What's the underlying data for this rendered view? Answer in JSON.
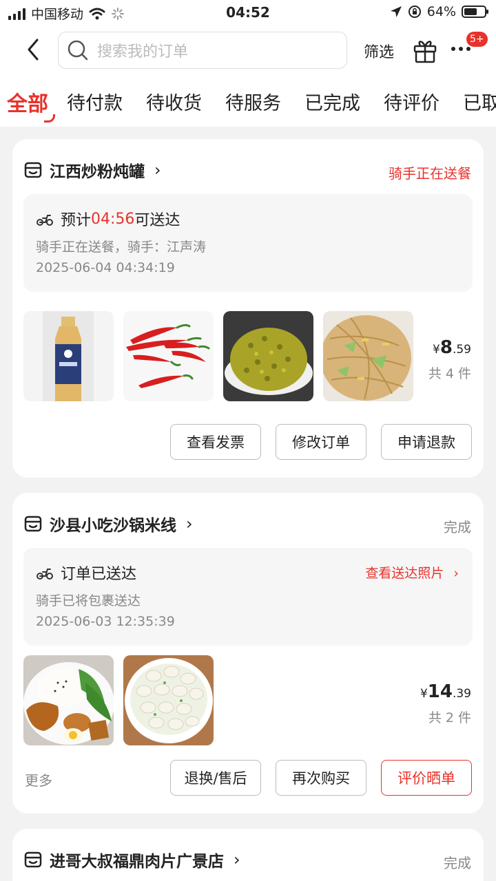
{
  "status_bar": {
    "carrier": "中国移动",
    "time": "04:52",
    "battery": "64%",
    "battery_level": 0.64
  },
  "header": {
    "search_placeholder": "搜索我的订单",
    "filter_label": "筛选",
    "more_badge": "5+"
  },
  "tabs": [
    {
      "label": "全部",
      "active": true
    },
    {
      "label": "待付款"
    },
    {
      "label": "待收货"
    },
    {
      "label": "待服务"
    },
    {
      "label": "已完成"
    },
    {
      "label": "待评价"
    },
    {
      "label": "已取"
    }
  ],
  "orders": [
    {
      "shop": "江西炒粉炖罐",
      "status": "骑手正在送餐",
      "eta_prefix": "预计",
      "eta_time": "04:56",
      "eta_suffix": "可送达",
      "rider_text": "骑手正在送餐，骑手：江声涛",
      "timestamp": "2025-06-04 04:34:19",
      "items": [
        "tea-bottle",
        "red-chili",
        "pickled-beans",
        "fried-rice-noodles"
      ],
      "price_symbol": "¥",
      "price_int": "8",
      "price_dec": ".59",
      "count": "共 4 件",
      "buttons": [
        "查看发票",
        "修改订单",
        "申请退款"
      ]
    },
    {
      "shop": "沙县小吃沙锅米线",
      "status": "完成",
      "delivered_label": "订单已送达",
      "photo_link": "查看送达照片",
      "rider_text": "骑手已将包裹送达",
      "timestamp": "2025-06-03 12:35:39",
      "items": [
        "chicken-leg-rice",
        "wonton-soup"
      ],
      "price_symbol": "¥",
      "price_int": "14",
      "price_dec": ".39",
      "count": "共 2 件",
      "more": "更多",
      "buttons": [
        "退换/售后",
        "再次购买",
        "评价晒单"
      ]
    },
    {
      "shop": "进哥大叔福鼎肉片广景店",
      "status": "完成"
    }
  ],
  "colors": {
    "accent": "#e8322b",
    "text": "#222222",
    "muted": "#888888",
    "background": "#f2f2f2"
  }
}
